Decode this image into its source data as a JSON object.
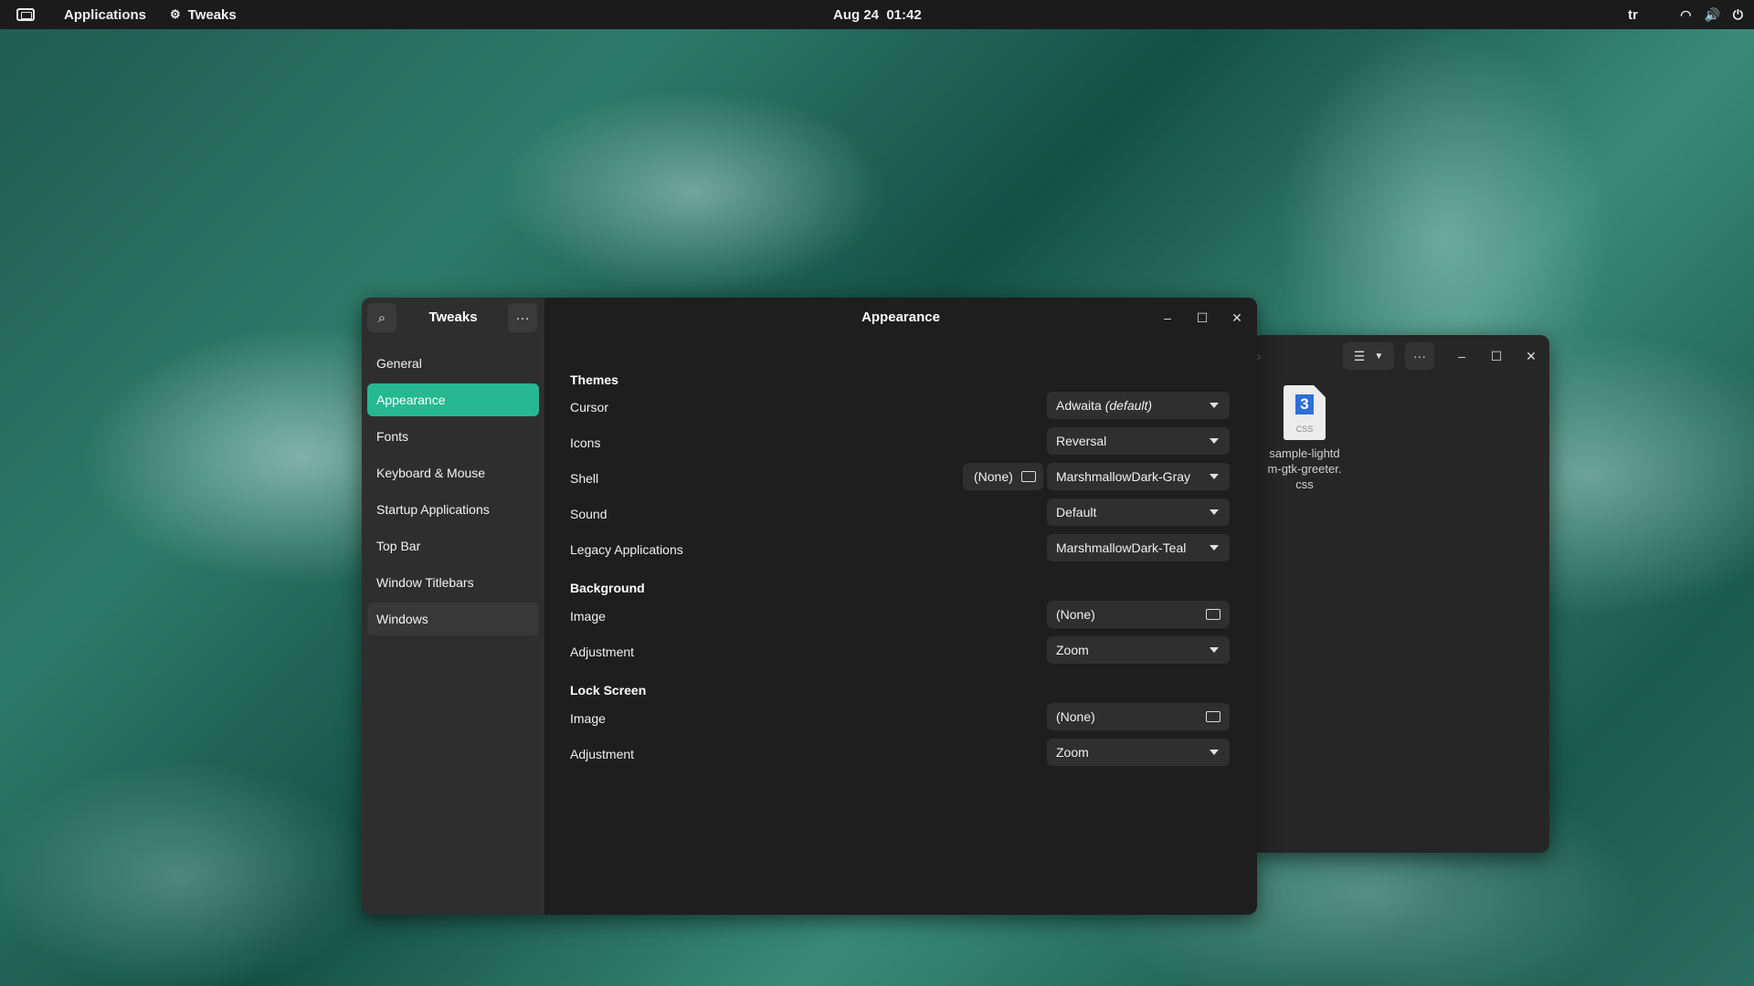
{
  "topbar": {
    "activities_icon": "activities-icon",
    "applications": "Applications",
    "app_name": "Tweaks",
    "datetime": "Aug 24  01:42",
    "keyboard_layout": "tr"
  },
  "files_window": {
    "file_icon_number": "3",
    "file_icon_ext": "CSS",
    "file_name": "sample-lightdm-gtk-greeter.css"
  },
  "tweaks": {
    "title": "Tweaks",
    "page_title": "Appearance",
    "sidebar": [
      {
        "label": "General"
      },
      {
        "label": "Appearance"
      },
      {
        "label": "Fonts"
      },
      {
        "label": "Keyboard & Mouse"
      },
      {
        "label": "Startup Applications"
      },
      {
        "label": "Top Bar"
      },
      {
        "label": "Window Titlebars"
      },
      {
        "label": "Windows"
      }
    ],
    "sections": {
      "themes": "Themes",
      "background": "Background",
      "lock_screen": "Lock Screen"
    },
    "rows": {
      "cursor": {
        "label": "Cursor",
        "value": "Adwaita",
        "value_suffix": "(default)"
      },
      "icons": {
        "label": "Icons",
        "value": "Reversal"
      },
      "shell": {
        "label": "Shell",
        "file_value": "(None)",
        "value": "MarshmallowDark-Gray"
      },
      "sound": {
        "label": "Sound",
        "value": "Default"
      },
      "legacy": {
        "label": "Legacy Applications",
        "value": "MarshmallowDark-Teal"
      },
      "bg_image": {
        "label": "Image",
        "value": "(None)"
      },
      "bg_adjust": {
        "label": "Adjustment",
        "value": "Zoom"
      },
      "ls_image": {
        "label": "Image",
        "value": "(None)"
      },
      "ls_adjust": {
        "label": "Adjustment",
        "value": "Zoom"
      }
    }
  },
  "colors": {
    "accent": "#26b890",
    "topbar": "#1b1b1b",
    "sidebar": "#2e2e2e",
    "content": "#1e1e1e"
  }
}
